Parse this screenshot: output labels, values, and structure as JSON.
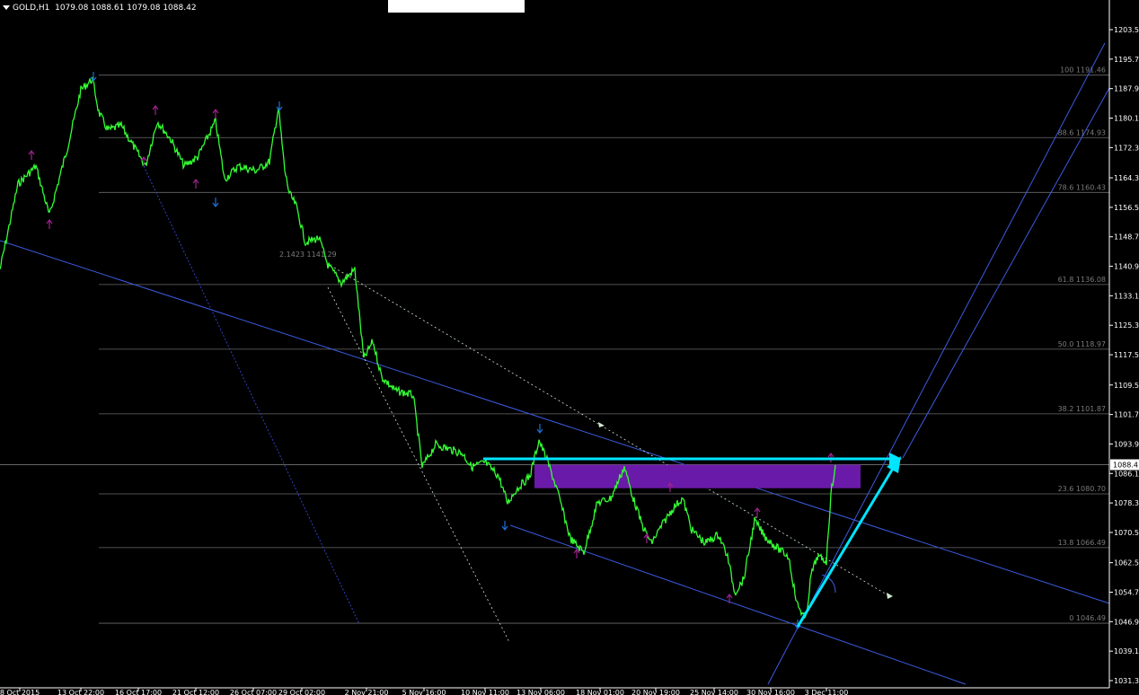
{
  "header": {
    "symbol": "GOLD,H1",
    "ohlc": "1079.08 1088.61 1079.08 1088.42"
  },
  "current_price_label": "1088.4",
  "colors": {
    "background": "#000000",
    "price": "#33ff33",
    "grid": "#6b6b6b",
    "channel": "#3c5be0",
    "cyan": "#00e5ff",
    "zone": "#6a1aa8",
    "fractal_up": "#1f6fd6",
    "fractal_down": "#a0208f"
  },
  "chart_data": {
    "type": "line",
    "title": "GOLD,H1",
    "y_ticks": [
      "1203.5",
      "1195.7",
      "1187.9",
      "1180.1",
      "1172.3",
      "1164.3",
      "1156.5",
      "1148.7",
      "1140.9",
      "1133.1",
      "1125.3",
      "1117.5",
      "1109.5",
      "1101.7",
      "1093.9",
      "1086.1",
      "1078.3",
      "1070.5",
      "1062.5",
      "1054.7",
      "1046.9",
      "1039.1",
      "1031.3"
    ],
    "x_ticks": [
      "8 Oct 2015",
      "13 Oct 22:00",
      "16 Oct 17:00",
      "21 Oct 12:00",
      "26 Oct 07:00",
      "29 Oct 02:00",
      "2 Nov 21:00",
      "5 Nov 16:00",
      "10 Nov 11:00",
      "13 Nov 06:00",
      "18 Nov 01:00",
      "20 Nov 19:00",
      "25 Nov 14:00",
      "30 Nov 16:00",
      "3 Dec 11:00"
    ],
    "fib_levels": [
      {
        "label": "100 1191.46",
        "value": 1191.46
      },
      {
        "label": "88.6 1174.93",
        "value": 1174.93
      },
      {
        "label": "78.6 1160.43",
        "value": 1160.43
      },
      {
        "label": "61.8 1136.08",
        "value": 1136.08
      },
      {
        "label": "50.0 1118.97",
        "value": 1118.97
      },
      {
        "label": "38.2 1101.87",
        "value": 1101.87
      },
      {
        "label": "23.6 1080.70",
        "value": 1080.7
      },
      {
        "label": "13.8 1066.49",
        "value": 1066.49
      },
      {
        "label": "0 1046.49",
        "value": 1046.49
      }
    ],
    "annotation": "2.1423 1141.29",
    "current_price": 1088.42,
    "grid": false
  }
}
